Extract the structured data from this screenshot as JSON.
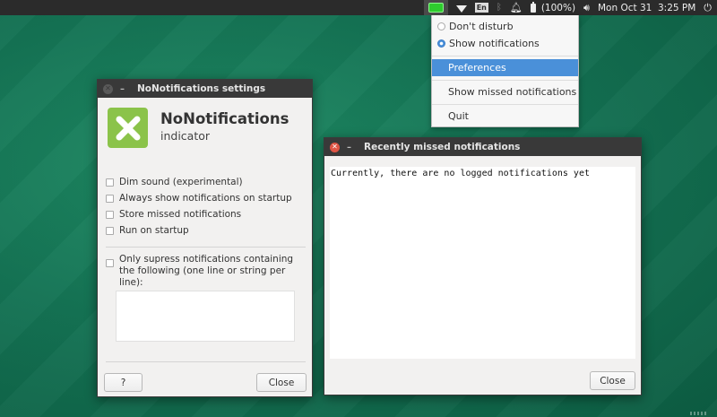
{
  "panel": {
    "battery_text": "(100%)",
    "clock": "Mon Oct 31  3:25 PM",
    "lang": "En",
    "icons": [
      "indicator-icon",
      "wifi-icon",
      "keyboard-lang-icon",
      "bluetooth-icon",
      "bell-icon",
      "battery-icon",
      "volume-icon",
      "power-icon"
    ],
    "indicator_color": "#2ecc2e"
  },
  "menu": {
    "radio_items": [
      {
        "label": "Don't disturb",
        "selected": false
      },
      {
        "label": "Show notifications",
        "selected": true
      }
    ],
    "items": [
      {
        "label": "Preferences",
        "highlighted": true
      },
      {
        "label": "Show missed notifications",
        "highlighted": false
      },
      {
        "label": "Quit",
        "highlighted": false
      }
    ]
  },
  "settings_window": {
    "title": "NoNotifications settings",
    "app_name": "NoNotifications",
    "app_subtitle": "indicator",
    "options": [
      {
        "label": "Dim sound (experimental)",
        "checked": false
      },
      {
        "label": "Always show notifications on startup",
        "checked": false
      },
      {
        "label": "Store missed notifications",
        "checked": false
      },
      {
        "label": "Run on startup",
        "checked": false
      }
    ],
    "suppress_option": {
      "label": "Only supress notifications containing the following (one line or string per line):",
      "checked": false
    },
    "suppress_text": "",
    "help_label": "?",
    "close_label": "Close",
    "logo_color": "#8bc34a"
  },
  "missed_window": {
    "title": "Recently missed notifications",
    "content": "Currently, there are no logged notifications yet",
    "close_label": "Close"
  }
}
